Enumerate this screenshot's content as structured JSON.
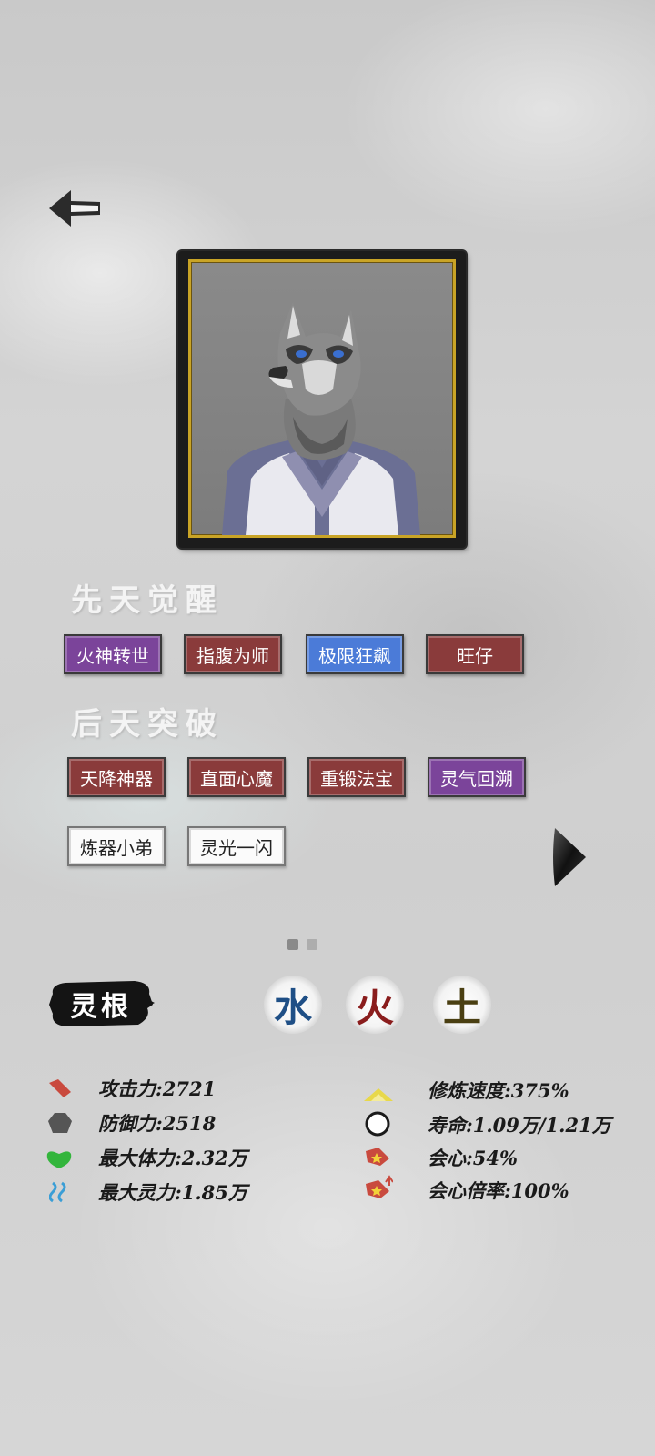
{
  "innate": {
    "title": "先天觉醒",
    "tags": [
      {
        "label": "火神转世",
        "color": "purple"
      },
      {
        "label": "指腹为师",
        "color": "red"
      },
      {
        "label": "极限狂飙",
        "color": "blue"
      },
      {
        "label": "旺仔",
        "color": "red"
      }
    ]
  },
  "acquired": {
    "title": "后天突破",
    "tags": [
      {
        "label": "天降神器",
        "color": "red"
      },
      {
        "label": "直面心魔",
        "color": "red"
      },
      {
        "label": "重锻法宝",
        "color": "red"
      },
      {
        "label": "灵气回溯",
        "color": "purple"
      },
      {
        "label": "炼器小弟",
        "color": "white"
      },
      {
        "label": "灵光一闪",
        "color": "white"
      }
    ]
  },
  "pager": {
    "pages": 2,
    "current": 1
  },
  "spirit_root": {
    "label": "灵根",
    "elements": [
      {
        "char": "水",
        "color": "#1f4f86"
      },
      {
        "char": "火",
        "color": "#8a1d1d"
      },
      {
        "char": "土",
        "color": "#4a3f12"
      }
    ]
  },
  "stats": {
    "attack": "攻击力:2721",
    "defense": "防御力:2518",
    "max_hp": "最大体力:2.32万",
    "max_spirit": "最大灵力:1.85万",
    "cultivation_speed": "修炼速度:375%",
    "lifespan": "寿命:1.09万/1.21万",
    "crit": "会心:54%",
    "crit_multiplier": "会心倍率:100%"
  }
}
